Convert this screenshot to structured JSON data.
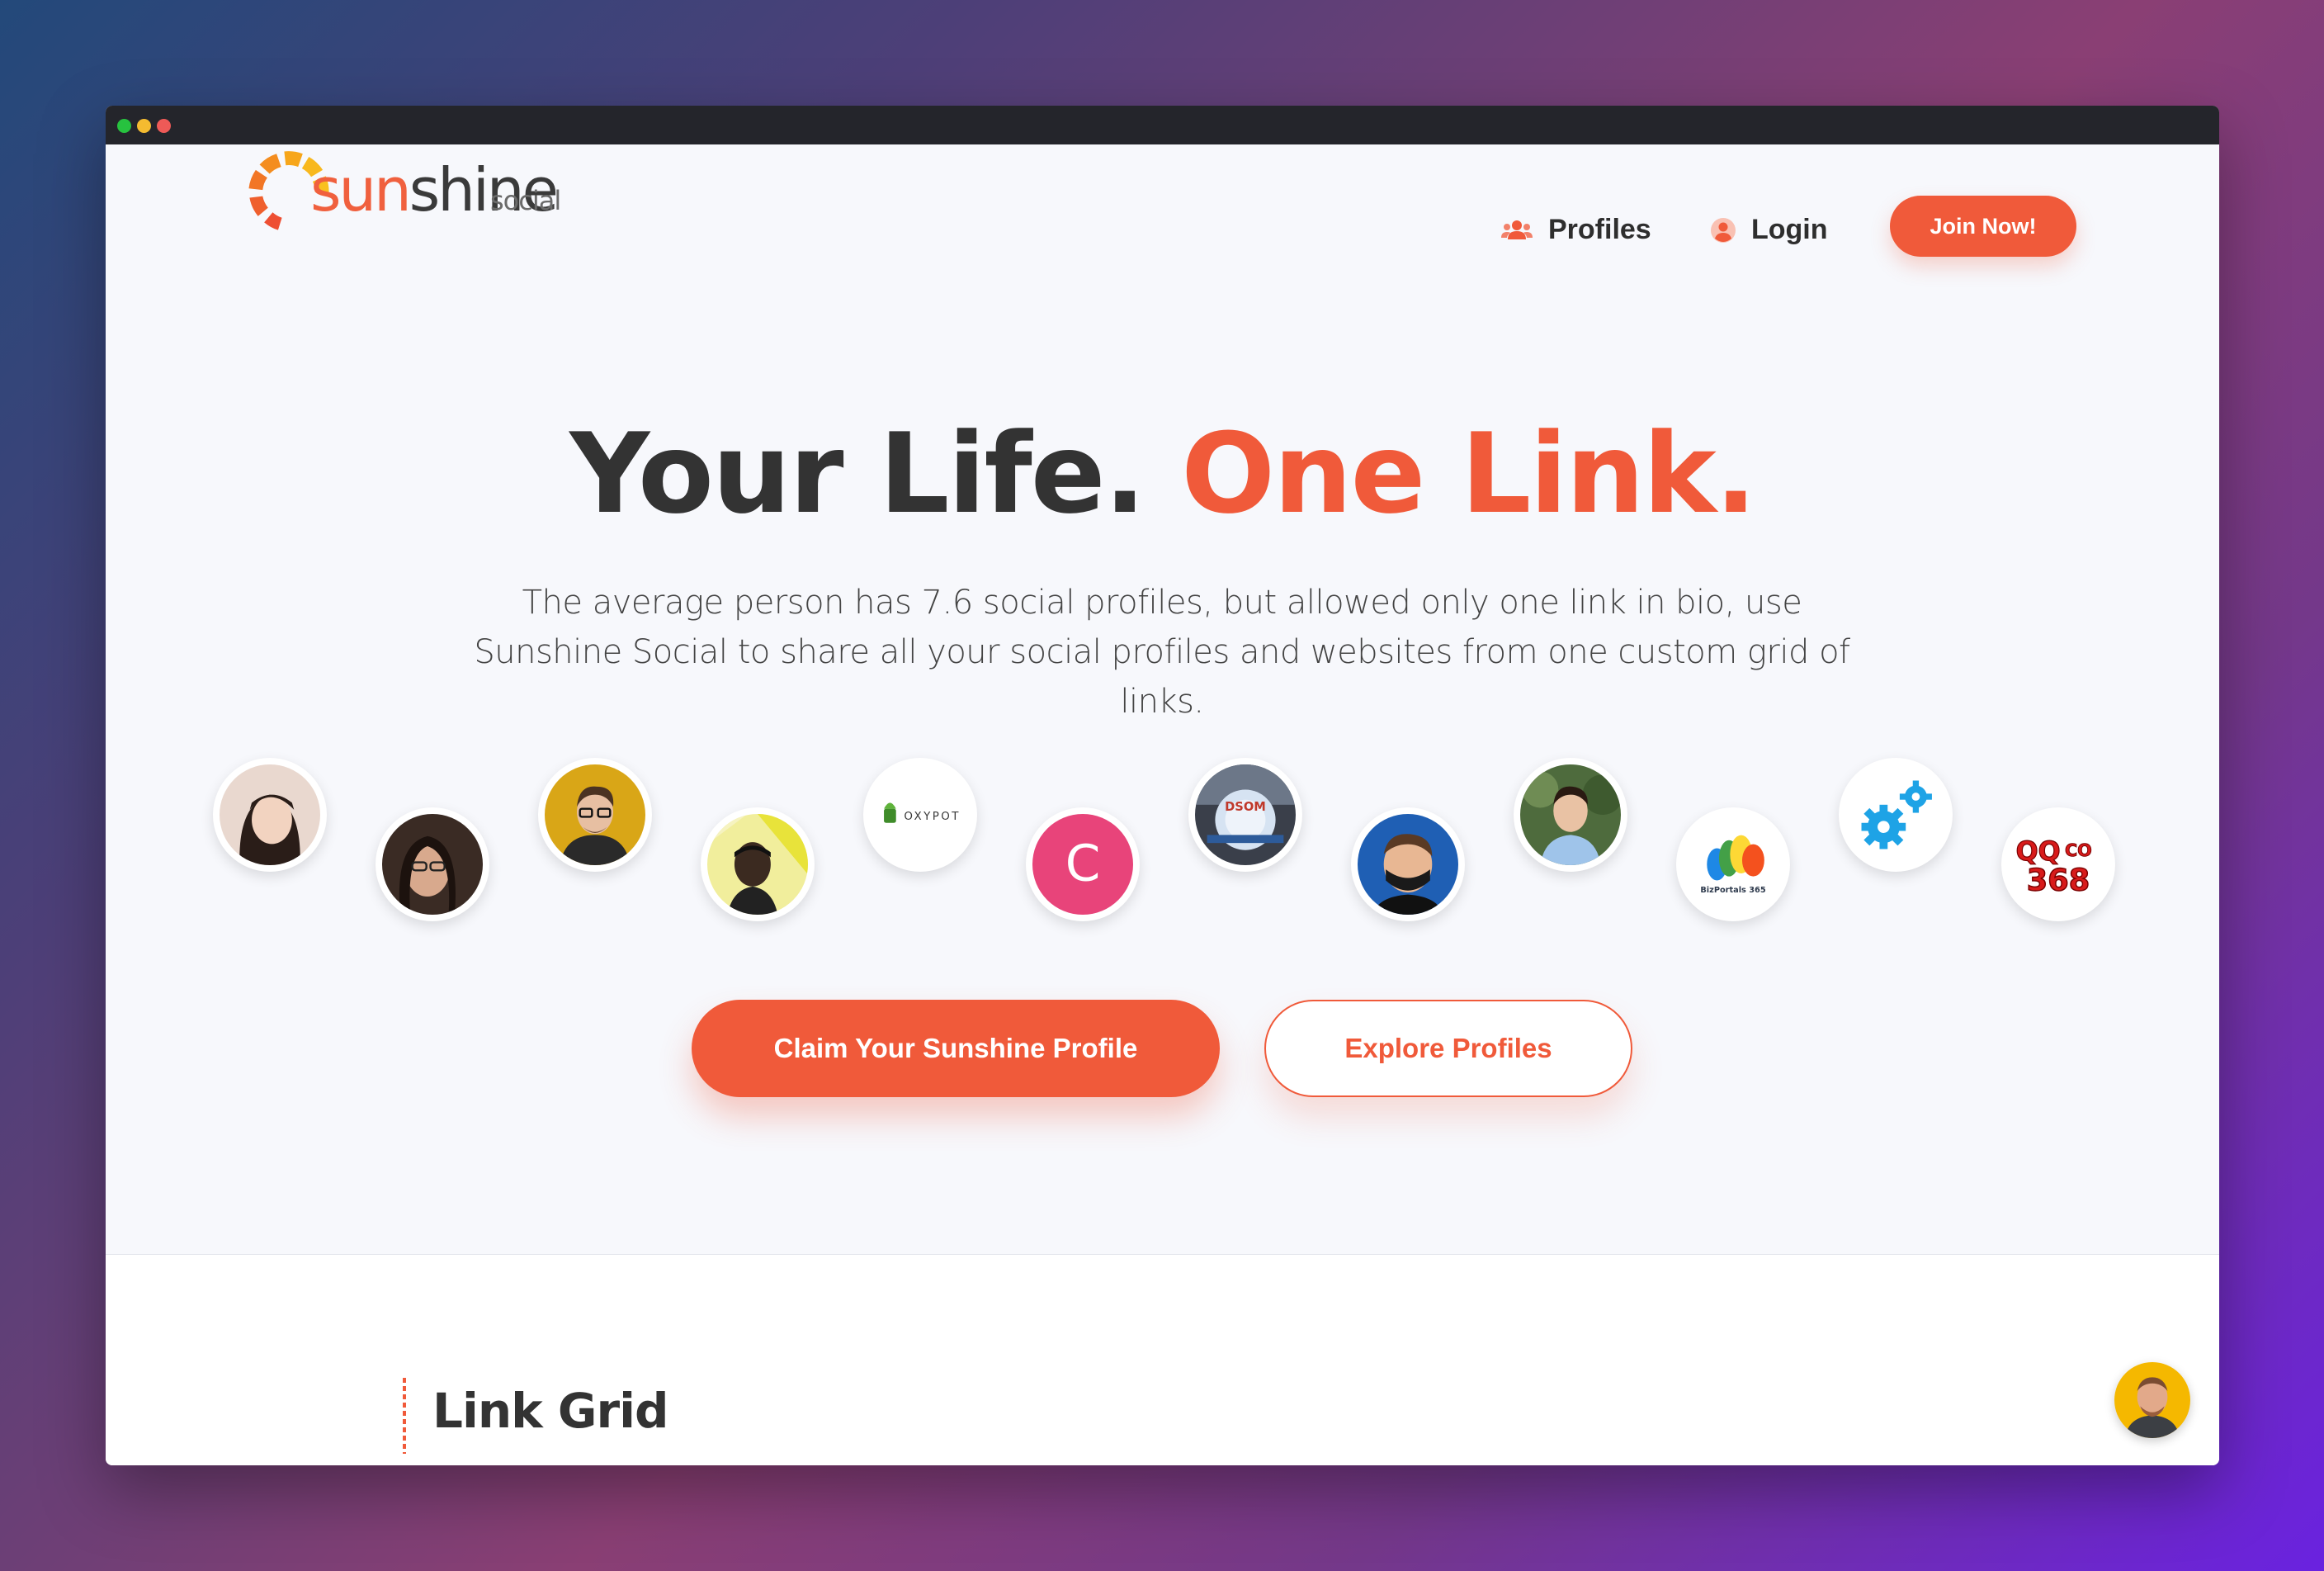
{
  "window": {
    "controls": [
      "close",
      "minimize",
      "maximize"
    ]
  },
  "brand": {
    "name_part1": "sun",
    "name_part2": "shine",
    "suffix": "social",
    "color": "#f05a3a"
  },
  "nav": {
    "items": [
      {
        "label": "Profiles",
        "icon": "users-icon"
      },
      {
        "label": "Login",
        "icon": "user-circle-icon"
      }
    ],
    "join_label": "Join Now!"
  },
  "hero": {
    "title_plain": "Your Life.",
    "title_accent": "One Link.",
    "subtitle": "The average person has 7.6 social profiles, but allowed only one link in bio, use Sunshine Social to share all your social profiles and websites from one custom grid of links."
  },
  "profiles": [
    {
      "kind": "person",
      "bg": "#e9d8cf"
    },
    {
      "kind": "person",
      "bg": "#3a2b24"
    },
    {
      "kind": "person",
      "bg": "#d9a617"
    },
    {
      "kind": "person",
      "bg": "#e8e33a"
    },
    {
      "kind": "logo",
      "text": "OXYPOT"
    },
    {
      "kind": "letter",
      "text": "C",
      "bg": "#e8447a"
    },
    {
      "kind": "logo",
      "text": "DSOM"
    },
    {
      "kind": "person",
      "bg": "#1f5fb4"
    },
    {
      "kind": "person",
      "bg": "#4e6b3d"
    },
    {
      "kind": "logo",
      "text": "BizPortals 365"
    },
    {
      "kind": "logo",
      "text": "gears"
    },
    {
      "kind": "logo",
      "text_top": "QQ",
      "text_right": "CO",
      "text_bottom": "368"
    }
  ],
  "cta": {
    "primary": "Claim Your Sunshine Profile",
    "secondary": "Explore Profiles"
  },
  "section": {
    "title": "Link Grid"
  }
}
